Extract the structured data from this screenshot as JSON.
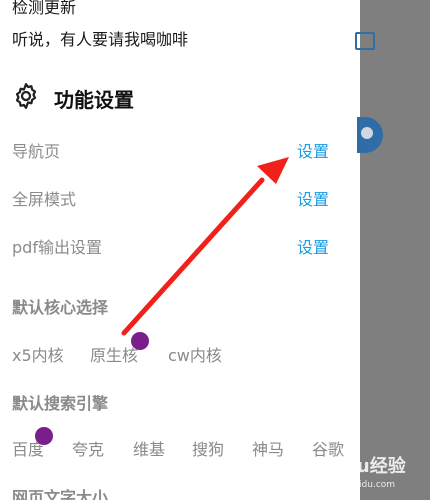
{
  "top": {
    "check_update": "检测更新",
    "coffee": "听说，有人要请我喝咖啡"
  },
  "section": {
    "icon": "gear-icon",
    "title": "功能设置"
  },
  "settings": [
    {
      "label": "导航页",
      "action": "设置"
    },
    {
      "label": "全屏模式",
      "action": "设置"
    },
    {
      "label": "pdf输出设置",
      "action": "设置"
    }
  ],
  "core": {
    "header": "默认核心选择",
    "options": [
      "x5内核",
      "原生核",
      "cw内核"
    ]
  },
  "search": {
    "header": "默认搜索引擎",
    "options": [
      "百度",
      "夸克",
      "维基",
      "搜狗",
      "神马",
      "谷歌"
    ]
  },
  "font_size": {
    "header": "网页文字大小"
  },
  "watermark": {
    "brand": "Baidu经验",
    "url": "jingyan.baidu.com"
  },
  "colors": {
    "link": "#1a9ae0",
    "arrow": "#f0201a",
    "dot": "#7a1e8c",
    "overlay": "#7f7f7f"
  }
}
